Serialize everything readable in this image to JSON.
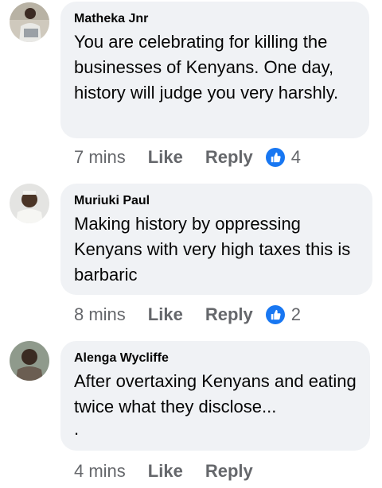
{
  "comments": [
    {
      "author": "Matheka Jnr",
      "text": "You are celebrating for killing the businesses of Kenyans. One day, history will judge you very harshly.",
      "time": "7 mins",
      "like_label": "Like",
      "reply_label": "Reply",
      "reaction_count": "4",
      "reaction_icon": "thumbs-up-icon"
    },
    {
      "author": "Muriuki Paul",
      "text": "Making history by oppressing Kenyans with very high taxes  this is barbaric",
      "time": "8 mins",
      "like_label": "Like",
      "reply_label": "Reply",
      "reaction_count": "2",
      "reaction_icon": "thumbs-up-icon"
    },
    {
      "author": "Alenga Wycliffe",
      "text": "After overtaxing Kenyans and eating twice what they disclose...",
      "text_extra": ".",
      "time": "4 mins",
      "like_label": "Like",
      "reply_label": "Reply"
    }
  ],
  "colors": {
    "bubble": "#f0f2f5",
    "meta_text": "#65676b",
    "like_blue": "#1877f2"
  }
}
